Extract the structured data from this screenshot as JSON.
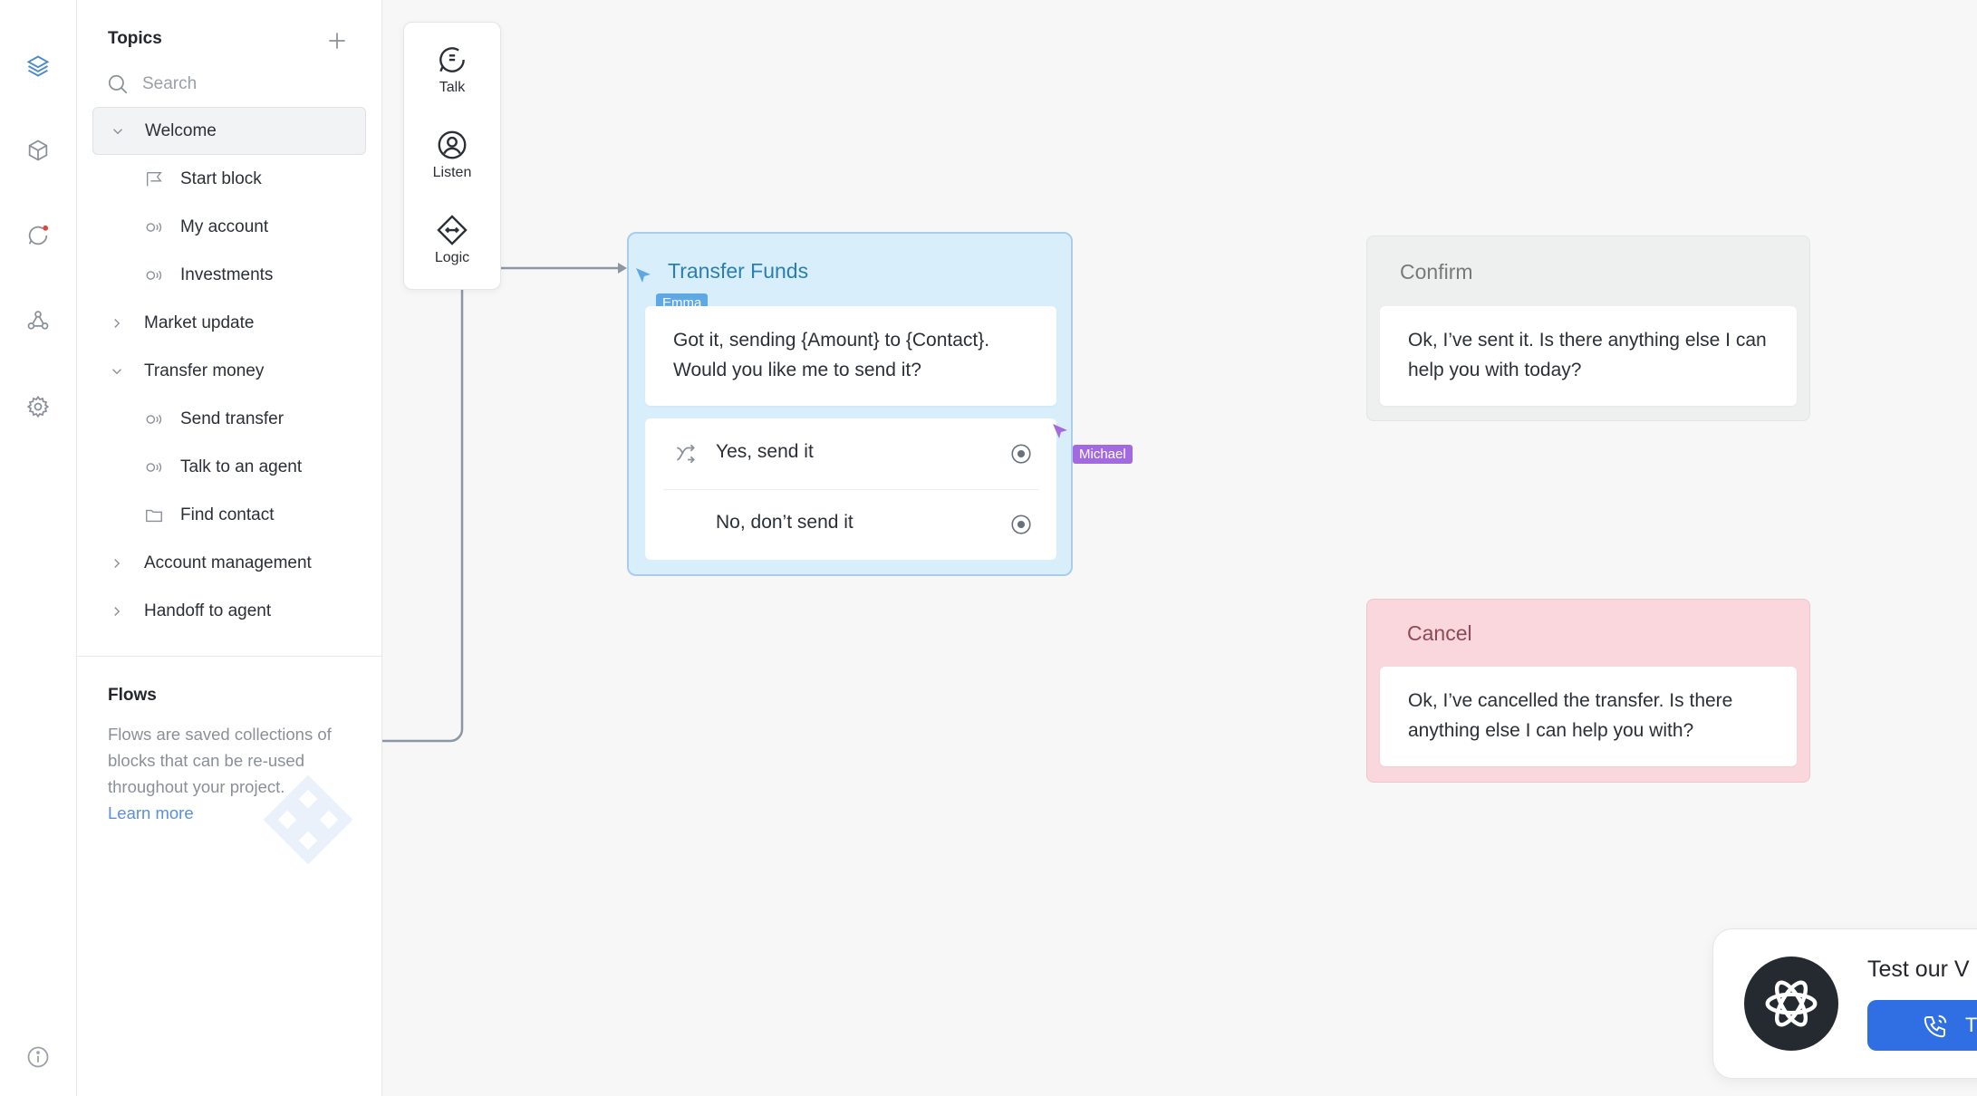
{
  "sidebar": {
    "topics_title": "Topics",
    "search_placeholder": "Search",
    "items": [
      {
        "label": "Welcome"
      },
      {
        "label": "Start block"
      },
      {
        "label": "My account"
      },
      {
        "label": "Investments"
      },
      {
        "label": "Market update"
      },
      {
        "label": "Transfer money"
      },
      {
        "label": "Send transfer"
      },
      {
        "label": "Talk to an agent"
      },
      {
        "label": "Find contact"
      },
      {
        "label": "Account management"
      },
      {
        "label": "Handoff to agent"
      }
    ],
    "flows": {
      "title": "Flows",
      "description": "Flows are saved collections of blocks that can be re-used throughout your project.",
      "learn_more": "Learn more"
    }
  },
  "palette": {
    "talk": "Talk",
    "listen": "Listen",
    "logic": "Logic"
  },
  "canvas": {
    "transfer_block": {
      "title": "Transfer Funds",
      "message": "Got it, sending {Amount} to {Contact}. Would you like me to send it?",
      "choices": [
        "Yes, send it",
        "No, don’t send it"
      ]
    },
    "confirm_block": {
      "title": "Confirm",
      "message": "Ok, I’ve sent it. Is there anything else I can help you with today?"
    },
    "cancel_block": {
      "title": "Cancel",
      "message": "Ok, I’ve cancelled the transfer. Is there anything else I can help you with?"
    },
    "collaborators": [
      "Emma",
      "Michael"
    ]
  },
  "test_widget": {
    "text": "Test our V",
    "button_label": "T"
  },
  "colors": {
    "accent_blue": "#2f6fe3",
    "emma": "#5ea8e6",
    "michael": "#a36ae0",
    "transfer_bg": "#d9eefb",
    "cancel_bg": "#f9d7dc",
    "confirm_bg": "#eef0ef"
  }
}
